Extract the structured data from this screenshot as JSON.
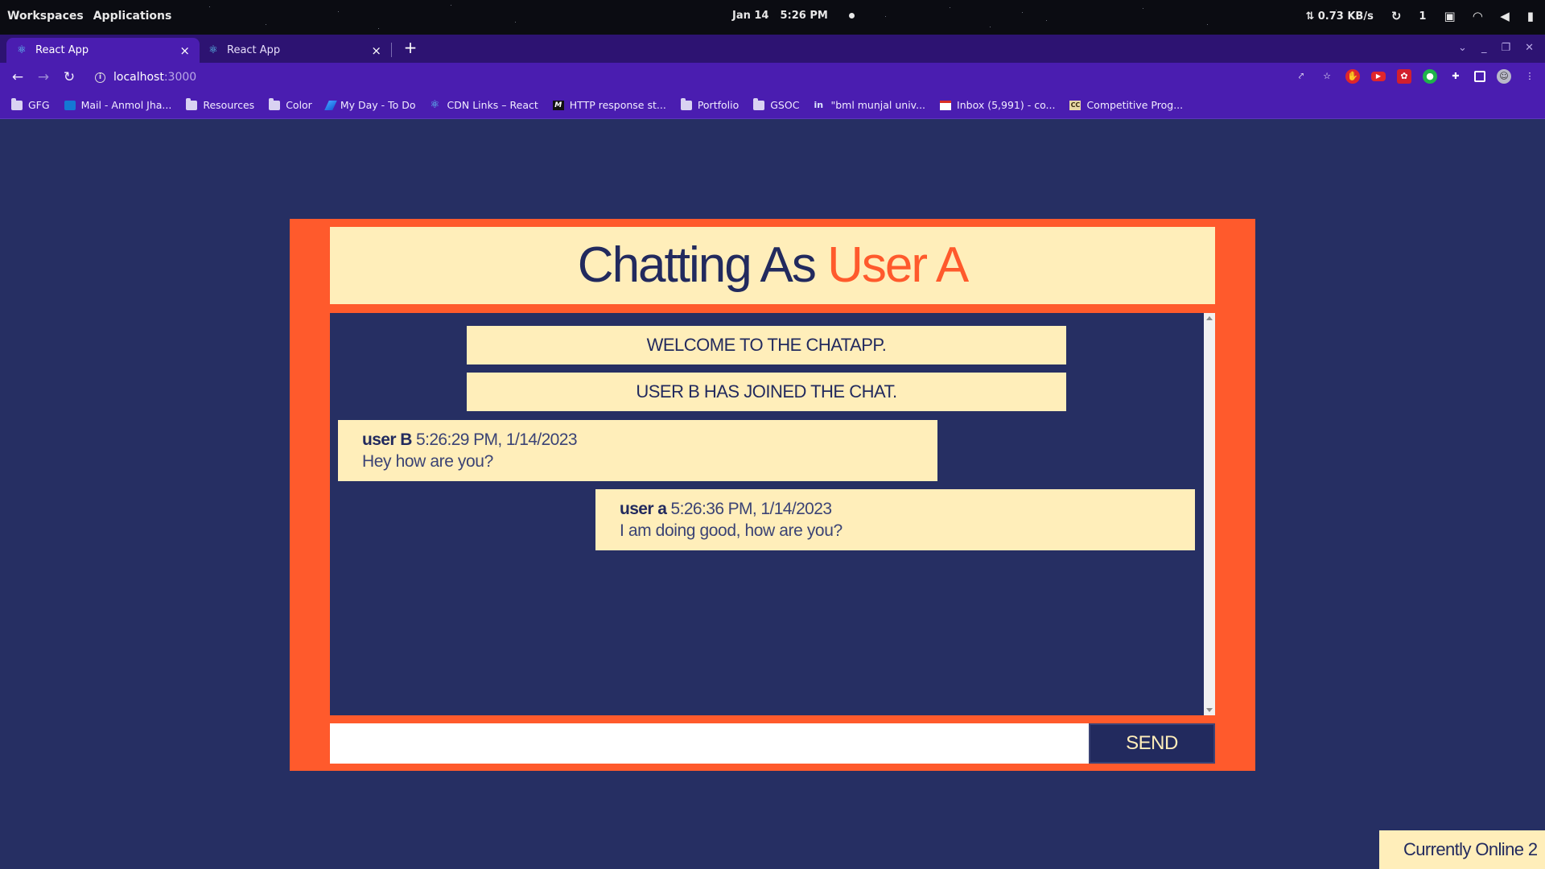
{
  "os_bar": {
    "workspaces": "Workspaces",
    "applications": "Applications",
    "date": "Jan 14",
    "time": "5:26 PM",
    "network_speed": "⇅ 0.73 KB/s",
    "workspace_number": "1"
  },
  "browser": {
    "tabs": [
      {
        "title": "React App",
        "active": true
      },
      {
        "title": "React App",
        "active": false
      }
    ],
    "url_host": "localhost",
    "url_port": ":3000",
    "bookmarks": [
      {
        "label": "GFG",
        "icon": "folder-icon"
      },
      {
        "label": "Mail - Anmol Jha...",
        "icon": "outlook-icon"
      },
      {
        "label": "Resources",
        "icon": "folder-icon"
      },
      {
        "label": "Color",
        "icon": "folder-icon"
      },
      {
        "label": "My Day - To Do",
        "icon": "todo-icon"
      },
      {
        "label": "CDN Links – React",
        "icon": "react-icon"
      },
      {
        "label": "HTTP response st...",
        "icon": "mdn-icon"
      },
      {
        "label": "Portfolio",
        "icon": "folder-icon"
      },
      {
        "label": "GSOC",
        "icon": "folder-icon"
      },
      {
        "label": "\"bml munjal univ...",
        "icon": "linkedin-icon"
      },
      {
        "label": "Inbox (5,991) - co...",
        "icon": "gmail-icon"
      },
      {
        "label": "Competitive Prog...",
        "icon": "cc-icon"
      }
    ]
  },
  "chat": {
    "header_prefix": "Chatting As",
    "header_user": "User A",
    "system_messages": [
      "WELCOME TO THE CHATAPP.",
      "USER B HAS JOINED THE CHAT."
    ],
    "messages": [
      {
        "author": "user B",
        "timestamp": "5:26:29 PM, 1/14/2023",
        "text": "Hey how are you?",
        "side": "left"
      },
      {
        "author": "user a",
        "timestamp": "5:26:36 PM, 1/14/2023",
        "text": "I am doing good, how are you?",
        "side": "right"
      }
    ],
    "input_value": "",
    "send_label": "SEND",
    "online_label": "Currently Online",
    "online_count": "2"
  },
  "colors": {
    "background": "#262f63",
    "accent": "#ff5a2c",
    "cream": "#ffeeba",
    "online_dot": "#1aa33b"
  }
}
